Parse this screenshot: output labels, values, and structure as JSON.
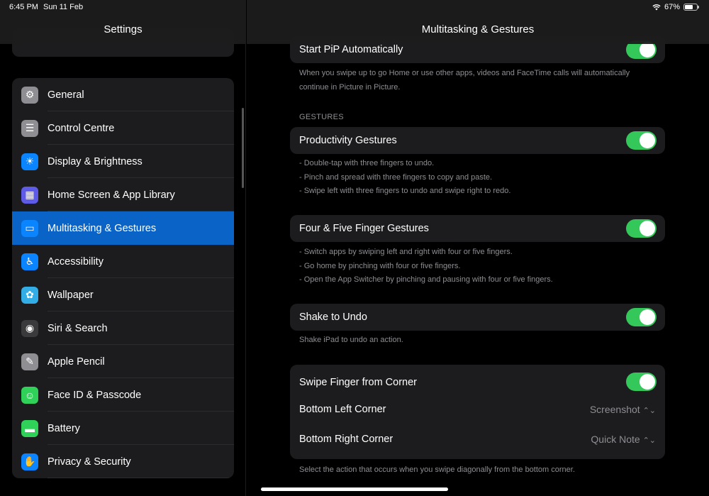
{
  "status": {
    "time": "6:45 PM",
    "date": "Sun 11 Feb",
    "battery": "67%",
    "battery_level": 0.67
  },
  "sidebar": {
    "title": "Settings",
    "items": [
      {
        "label": "General",
        "icon": "gear-icon",
        "color": "#8e8e93",
        "glyph": "⚙"
      },
      {
        "label": "Control Centre",
        "icon": "switches-icon",
        "color": "#8e8e93",
        "glyph": "☰"
      },
      {
        "label": "Display & Brightness",
        "icon": "sun-icon",
        "color": "#0a84ff",
        "glyph": "☀"
      },
      {
        "label": "Home Screen & App Library",
        "icon": "grid-icon",
        "color": "#5e5ce6",
        "glyph": "▦"
      },
      {
        "label": "Multitasking & Gestures",
        "icon": "multitasking-icon",
        "color": "#0a84ff",
        "glyph": "▭",
        "selected": true
      },
      {
        "label": "Accessibility",
        "icon": "accessibility-icon",
        "color": "#0a84ff",
        "glyph": "♿"
      },
      {
        "label": "Wallpaper",
        "icon": "flower-icon",
        "color": "#32ade6",
        "glyph": "✿"
      },
      {
        "label": "Siri & Search",
        "icon": "siri-icon",
        "color": "#3a3a3c",
        "glyph": "◉"
      },
      {
        "label": "Apple Pencil",
        "icon": "pencil-icon",
        "color": "#8e8e93",
        "glyph": "✎"
      },
      {
        "label": "Face ID & Passcode",
        "icon": "faceid-icon",
        "color": "#30d158",
        "glyph": "☺"
      },
      {
        "label": "Battery",
        "icon": "battery-icon",
        "color": "#30d158",
        "glyph": "▬"
      },
      {
        "label": "Privacy & Security",
        "icon": "hand-icon",
        "color": "#0a84ff",
        "glyph": "✋"
      }
    ]
  },
  "main": {
    "title": "Multitasking & Gestures",
    "pip": {
      "label": "Start PiP Automatically",
      "on": true,
      "note_1": "When you swipe up to go Home or use other apps, videos and FaceTime calls will automatically",
      "note_2": "continue in Picture in Picture."
    },
    "gestures_header": "GESTURES",
    "productivity": {
      "label": "Productivity Gestures",
      "on": true,
      "notes": [
        "- Double-tap with three fingers to undo.",
        "- Pinch and spread with three fingers to copy and paste.",
        "- Swipe left with three fingers to undo and swipe right to redo."
      ]
    },
    "four_five": {
      "label": "Four & Five Finger Gestures",
      "on": true,
      "notes": [
        "- Switch apps by swiping left and right with four or five fingers.",
        "- Go home by pinching with four or five fingers.",
        "- Open the App Switcher by pinching and pausing with four or five fingers."
      ]
    },
    "shake": {
      "label": "Shake to Undo",
      "on": true,
      "note": "Shake iPad to undo an action."
    },
    "corner": {
      "label": "Swipe Finger from Corner",
      "on": true,
      "bottom_left_label": "Bottom Left Corner",
      "bottom_left_value": "Screenshot",
      "bottom_right_label": "Bottom Right Corner",
      "bottom_right_value": "Quick Note",
      "note": "Select the action that occurs when you swipe diagonally from the bottom corner."
    }
  }
}
